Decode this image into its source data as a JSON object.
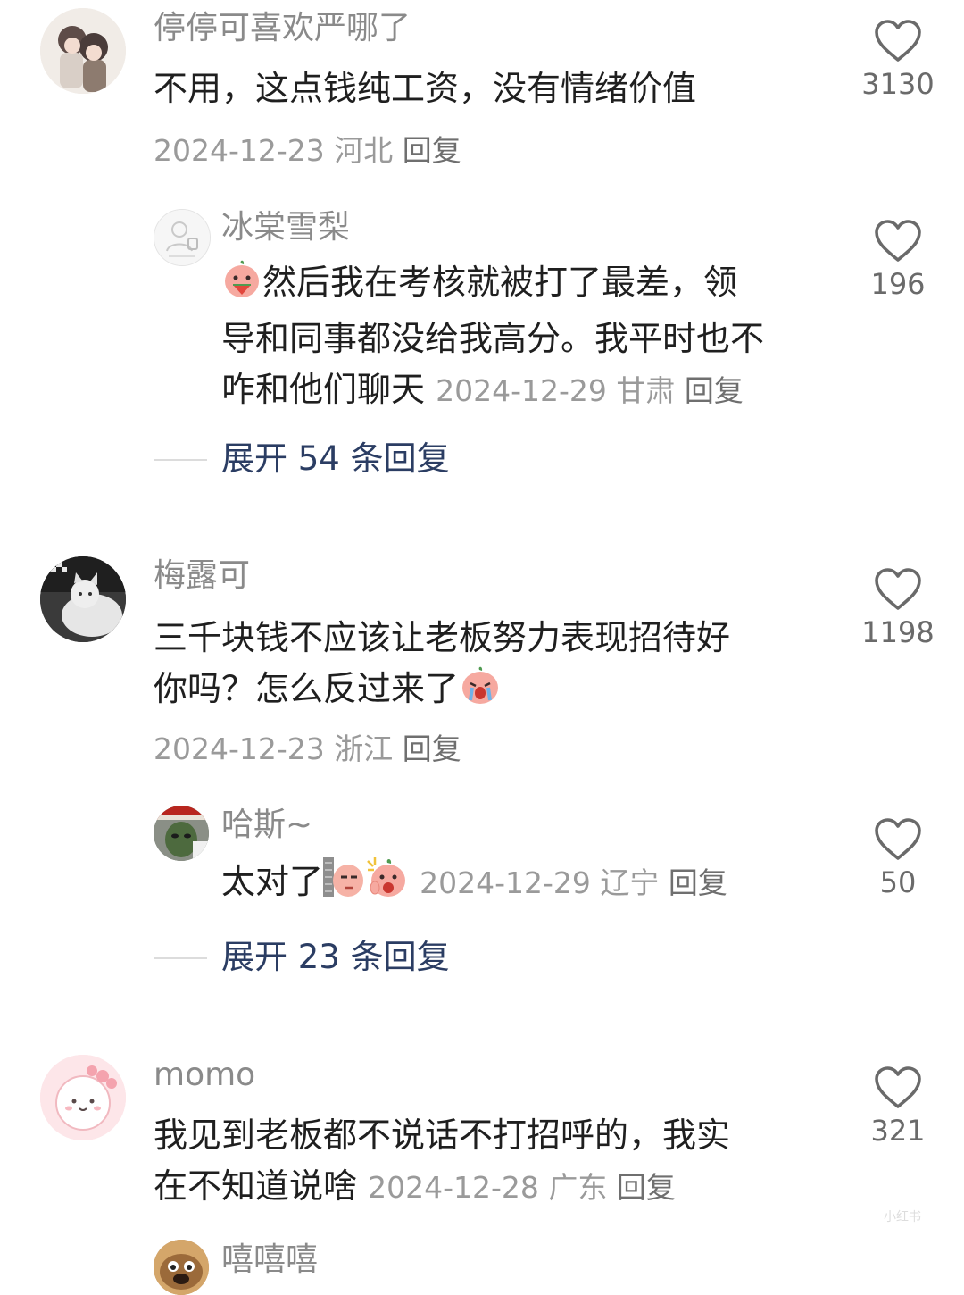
{
  "comments": [
    {
      "user": "停停可喜欢严哪了",
      "text": "不用，这点钱纯工资，没有情绪价值",
      "date": "2024-12-23",
      "location": "河北",
      "reply_label": "回复",
      "likes": "3130",
      "reply": {
        "user": "冰棠雪梨",
        "text_line1": "然后我在考核就被打了最差，领",
        "text_line2": "导和同事都没给我高分。我平时也不",
        "text_line3": "咋和他们聊天",
        "date": "2024-12-29",
        "location": "甘肃",
        "reply_label": "回复",
        "likes": "196"
      },
      "expand_label": "展开 54 条回复"
    },
    {
      "user": "梅露可",
      "text_line1": "三千块钱不应该让老板努力表现招待好",
      "text_line2": "你吗？怎么反过来了",
      "date": "2024-12-23",
      "location": "浙江",
      "reply_label": "回复",
      "likes": "1198",
      "reply": {
        "user": "哈斯~",
        "text": "太对了",
        "date": "2024-12-29",
        "location": "辽宁",
        "reply_label": "回复",
        "likes": "50"
      },
      "expand_label": "展开 23 条回复"
    },
    {
      "user": "momo",
      "text_line1": "我见到老板都不说话不打招呼的，我实",
      "text_line2": "在不知道说啥",
      "date": "2024-12-28",
      "location": "广东",
      "reply_label": "回复",
      "likes": "321"
    },
    {
      "user": "嘻嘻嘻"
    }
  ],
  "watermark": "小红书",
  "colors": {
    "name": "#8a8a8a",
    "meta": "#9a9a9a",
    "expand": "#2b3d63",
    "text": "#1f1f1f"
  }
}
